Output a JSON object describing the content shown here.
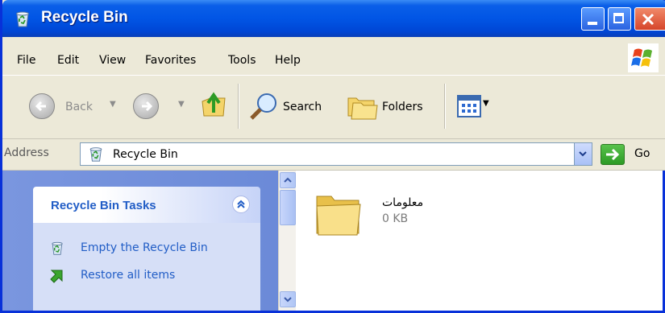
{
  "window": {
    "title": "Recycle Bin"
  },
  "menu": {
    "items": [
      "File",
      "Edit",
      "View",
      "Favorites",
      "Tools",
      "Help"
    ]
  },
  "toolbar": {
    "back_label": "Back",
    "search_label": "Search",
    "folders_label": "Folders"
  },
  "address": {
    "label": "Address",
    "value": "Recycle Bin",
    "go_label": "Go"
  },
  "tasks": {
    "title": "Recycle Bin Tasks",
    "items": [
      "Empty the Recycle Bin",
      "Restore all items"
    ]
  },
  "files": [
    {
      "name": "معلومات",
      "size": "0 KB",
      "icon": "folder-icon"
    }
  ],
  "colors": {
    "titlebar": "#0155e5",
    "task_link": "#215dc6",
    "taskpane": "#7a96df"
  }
}
